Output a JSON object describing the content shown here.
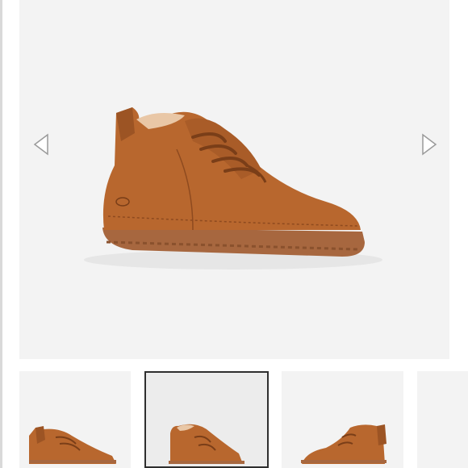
{
  "product": {
    "image_alt": "",
    "colors": {
      "page_background": "#ffffff",
      "image_background": "#f3f3f3",
      "suede": "#b8672e",
      "suede_shadow": "#8e4a1f",
      "sole": "#a7673f",
      "lining": "#e9c7a6",
      "selected_border": "#2e2e2e",
      "arrow_fill": "#ffffff",
      "arrow_stroke": "#9a9a9a"
    }
  },
  "gallery": {
    "prev_icon": "chevron-left-icon",
    "next_icon": "chevron-right-icon",
    "selected_index": 1,
    "thumbnails": [
      {
        "view": "angled-right"
      },
      {
        "view": "side-left"
      },
      {
        "view": "side-right"
      },
      {
        "view": "partial"
      }
    ]
  }
}
